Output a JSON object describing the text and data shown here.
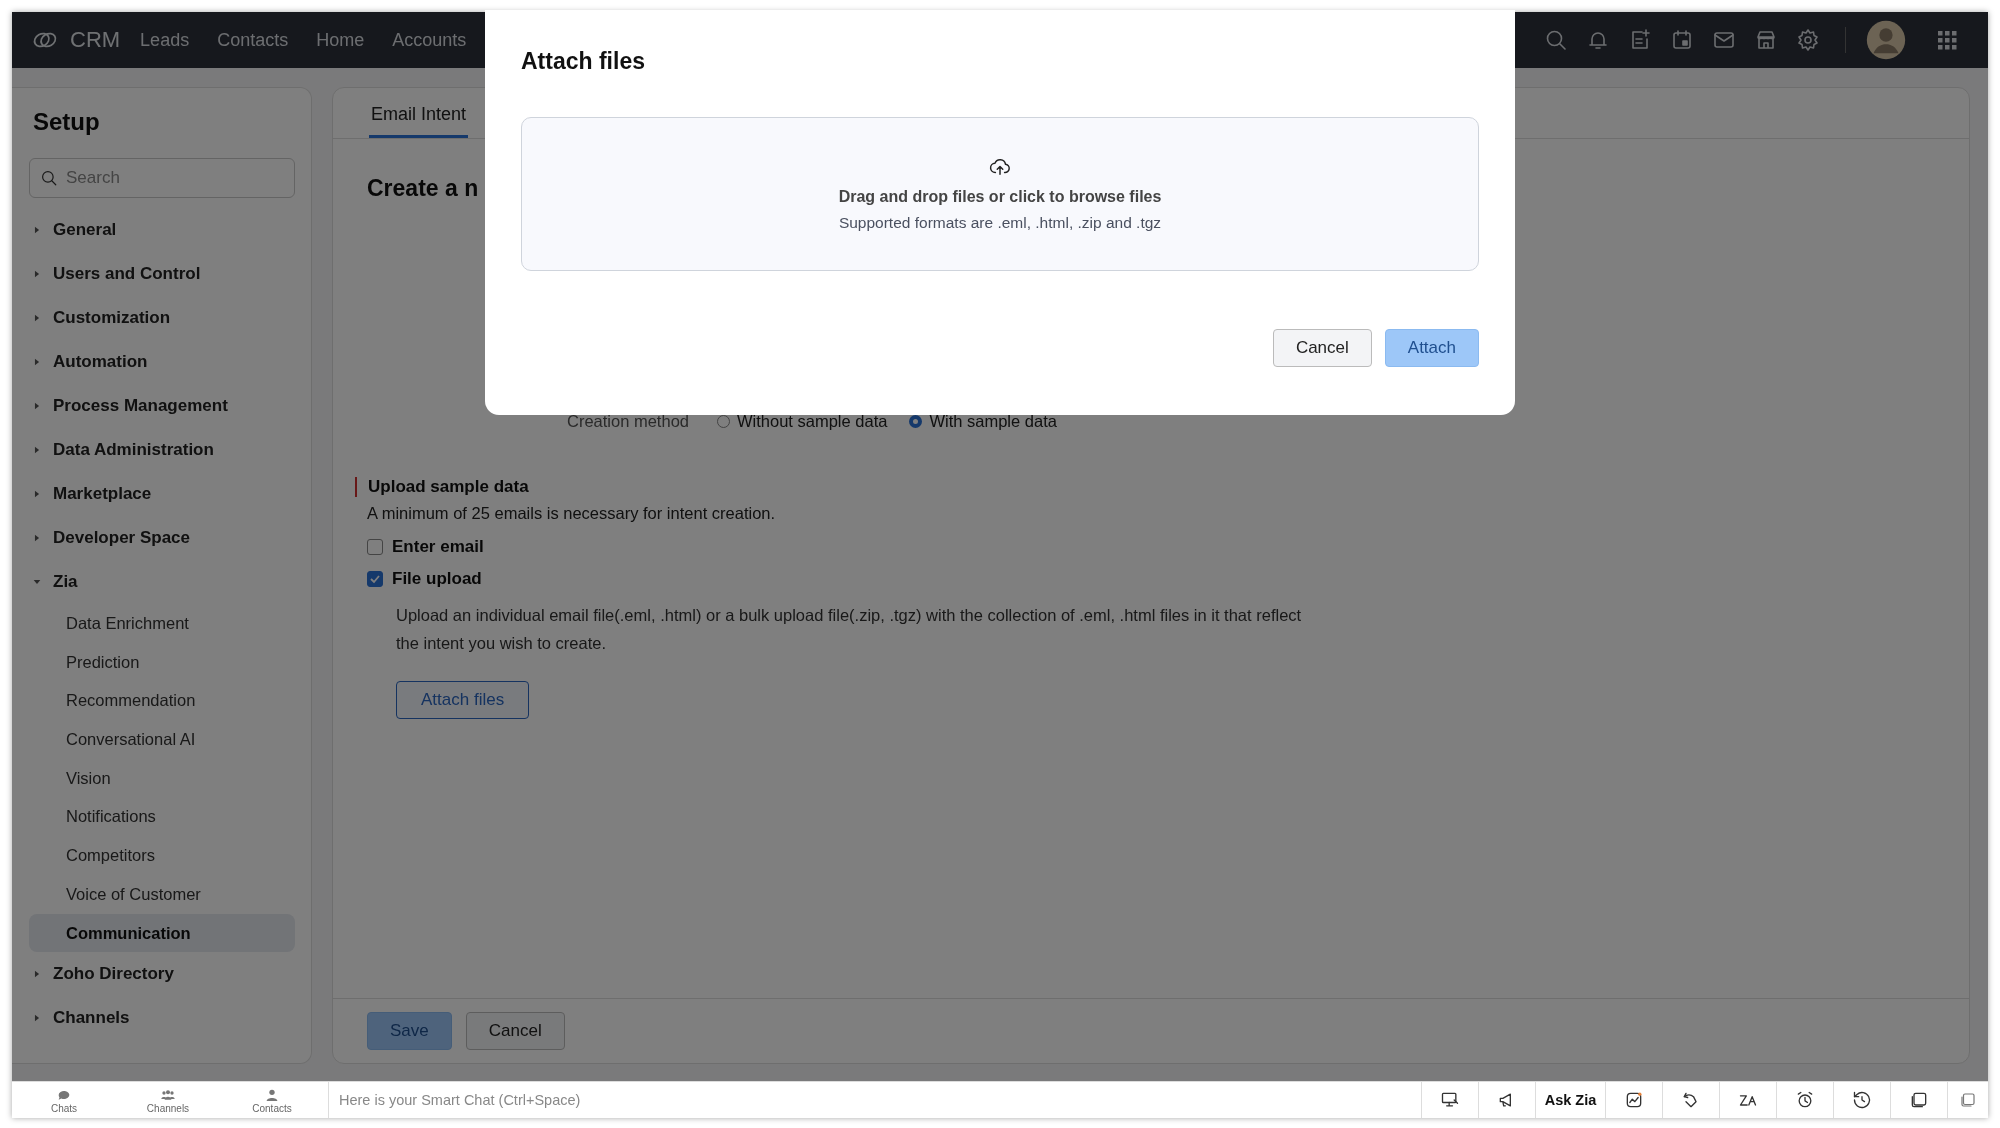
{
  "top_nav": {
    "brand": "CRM",
    "tabs": [
      {
        "label": "Leads",
        "selected": false
      },
      {
        "label": "Contacts",
        "selected": false
      },
      {
        "label": "Home",
        "selected": false
      },
      {
        "label": "Accounts",
        "selected": false
      }
    ]
  },
  "sidebar": {
    "title": "Setup",
    "search": {
      "placeholder": "Search"
    },
    "items": [
      {
        "label": "General",
        "expanded": false
      },
      {
        "label": "Users and Control",
        "expanded": false
      },
      {
        "label": "Customization",
        "expanded": false
      },
      {
        "label": "Automation",
        "expanded": false
      },
      {
        "label": "Process Management",
        "expanded": false
      },
      {
        "label": "Data Administration",
        "expanded": false
      },
      {
        "label": "Marketplace",
        "expanded": false
      },
      {
        "label": "Developer Space",
        "expanded": false
      },
      {
        "label": "Zia",
        "expanded": true,
        "children": [
          {
            "label": "Data Enrichment",
            "selected": false
          },
          {
            "label": "Prediction",
            "selected": false
          },
          {
            "label": "Recommendation",
            "selected": false
          },
          {
            "label": "Conversational AI",
            "selected": false
          },
          {
            "label": "Vision",
            "selected": false
          },
          {
            "label": "Notifications",
            "selected": false
          },
          {
            "label": "Competitors",
            "selected": false
          },
          {
            "label": "Voice of Customer",
            "selected": false
          },
          {
            "label": "Communication",
            "selected": true
          }
        ]
      },
      {
        "label": "Zoho Directory",
        "expanded": false
      },
      {
        "label": "Channels",
        "expanded": false
      }
    ]
  },
  "main": {
    "tabs": [
      {
        "label": "Email Intent",
        "selected": true
      }
    ],
    "heading": "Create a n",
    "creation_method": {
      "label": "Creation method",
      "options": [
        {
          "label": "Without sample data",
          "selected": false
        },
        {
          "label": "With sample data",
          "selected": true
        }
      ]
    },
    "upload": {
      "title": "Upload sample data",
      "required": true,
      "note": "A minimum of 25 emails is necessary for intent creation.",
      "options": [
        {
          "label": "Enter email",
          "checked": false
        },
        {
          "label": "File upload",
          "checked": true
        }
      ],
      "description": "Upload an individual email file(.eml, .html) or a bulk upload file(.zip, .tgz) with the collection of .eml, .html files in it that reflect the intent you wish to create.",
      "button": "Attach files"
    },
    "footer_buttons": [
      {
        "label": "Save",
        "kind": "primary",
        "disabled": true
      },
      {
        "label": "Cancel",
        "kind": "secondary",
        "disabled": false
      }
    ]
  },
  "modal": {
    "title": "Attach files",
    "dropzone": {
      "text": "Drag and drop files or click to browse files",
      "hint": "Supported formats are .eml, .html, .zip and .tgz"
    },
    "buttons": [
      {
        "label": "Cancel",
        "kind": "secondary",
        "disabled": false
      },
      {
        "label": "Attach",
        "kind": "primary",
        "disabled": true
      }
    ]
  },
  "bottom_bar": {
    "apps": [
      {
        "label": "Chats"
      },
      {
        "label": "Channels"
      },
      {
        "label": "Contacts"
      }
    ],
    "chat": {
      "placeholder": "Here is your Smart Chat (Ctrl+Space)"
    },
    "tools": [
      {
        "kind": "icon"
      },
      {
        "kind": "icon"
      },
      {
        "kind": "text",
        "label": "Ask Zia"
      },
      {
        "kind": "icon"
      },
      {
        "kind": "icon"
      },
      {
        "kind": "icon"
      },
      {
        "kind": "icon"
      },
      {
        "kind": "icon"
      },
      {
        "kind": "icon"
      }
    ]
  }
}
